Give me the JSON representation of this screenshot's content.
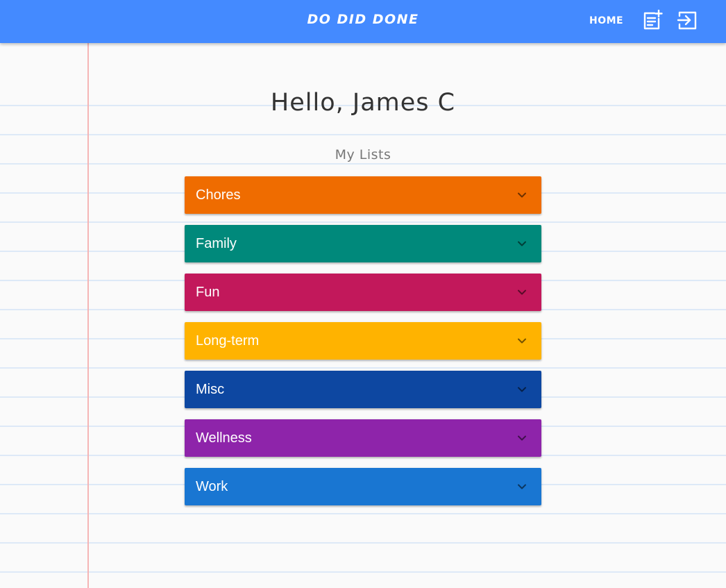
{
  "app": {
    "title": "DO DID DONE",
    "home_label": "HOME"
  },
  "icons": {
    "add_list": "note-add-icon",
    "logout": "exit-icon",
    "expand": "chevron-down-icon"
  },
  "main": {
    "greeting": "Hello, James C",
    "subtitle": "My Lists",
    "lists": [
      {
        "label": "Chores",
        "color": "#ef6c00"
      },
      {
        "label": "Family",
        "color": "#00897b"
      },
      {
        "label": "Fun",
        "color": "#c2185b"
      },
      {
        "label": "Long-term",
        "color": "#ffb300"
      },
      {
        "label": "Misc",
        "color": "#0d47a1"
      },
      {
        "label": "Wellness",
        "color": "#8e24aa"
      },
      {
        "label": "Work",
        "color": "#1976d2"
      }
    ]
  },
  "colors": {
    "appbar": "#448aff",
    "paper": "#fafafa",
    "rule_line": "#dde9f7",
    "margin_line": "#f5b5b5"
  }
}
